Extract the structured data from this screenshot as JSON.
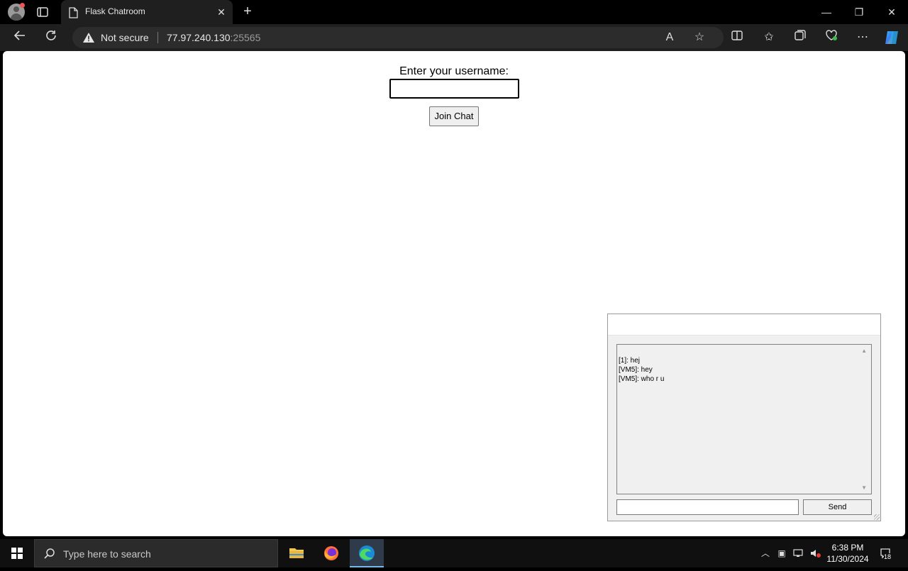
{
  "browser": {
    "tab_title": "Flask Chatroom",
    "security_label": "Not secure",
    "url_host": "77.97.240.130",
    "url_port": ":25565"
  },
  "page": {
    "username_label": "Enter your username:",
    "username_value": "",
    "join_button": "Join Chat"
  },
  "chat": {
    "messages": [
      "[1]: hej",
      "[VM5]: hey",
      "[VM5]: who r u"
    ],
    "input_value": "",
    "send_button": "Send"
  },
  "taskbar": {
    "search_placeholder": "Type here to search",
    "time": "6:38 PM",
    "date": "11/30/2024",
    "notification_count": "18"
  }
}
